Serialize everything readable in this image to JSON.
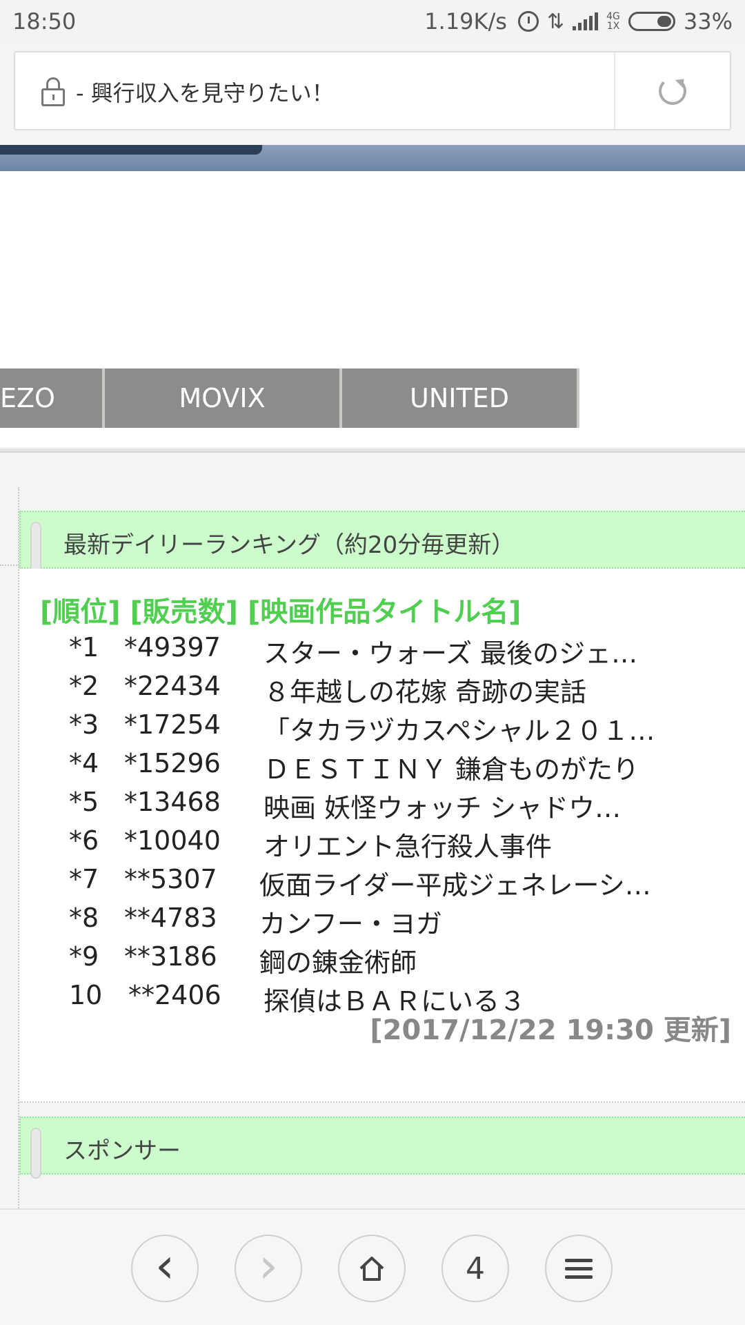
{
  "status_bar": {
    "time": "18:50",
    "speed": "1.19K/s",
    "network_top": "4G",
    "network_bottom": "1X",
    "battery": "33%"
  },
  "address_bar": {
    "page_title": "- 興行収入を見守りたい！"
  },
  "nav_tabs": [
    "EZO",
    "MOVIX",
    "UNITED"
  ],
  "ranking": {
    "header": "最新デイリーランキング（約20分毎更新）",
    "column_heading": "[順位] [販売数] [映画作品タイトル名]",
    "rows": [
      {
        "pos": "*1",
        "sales": "*49397",
        "title": "スター・ウォーズ 最後のジェ…"
      },
      {
        "pos": "*2",
        "sales": "*22434",
        "title": " ８年越しの花嫁 奇跡の実話"
      },
      {
        "pos": "*3",
        "sales": "*17254",
        "title": " 「タカラヅカスペシャル２０１…"
      },
      {
        "pos": "*4",
        "sales": "*15296",
        "title": " ＤＥＳＴＩＮＹ 鎌倉ものがたり"
      },
      {
        "pos": "*5",
        "sales": "*13468",
        "title": "映画 妖怪ウォッチ シャドウ…"
      },
      {
        "pos": "*6",
        "sales": "*10040",
        "title": "オリエント急行殺人事件"
      },
      {
        "pos": "*7",
        "sales": "**5307",
        "title": "仮面ライダー平成ジェネレーシ…"
      },
      {
        "pos": "*8",
        "sales": "**4783",
        "title": "カンフー・ヨガ"
      },
      {
        "pos": "*9",
        "sales": "**3186",
        "title": "鋼の錬金術師"
      },
      {
        "pos": "10",
        "sales": " **2406",
        "title": "探偵はＢＡＲにいる３"
      }
    ],
    "updated": "[2017/12/22 19:30 更新]"
  },
  "sponsor": {
    "header": "スポンサー"
  },
  "toolbar": {
    "back": "‹",
    "forward": "›",
    "tabs_count": "4"
  }
}
